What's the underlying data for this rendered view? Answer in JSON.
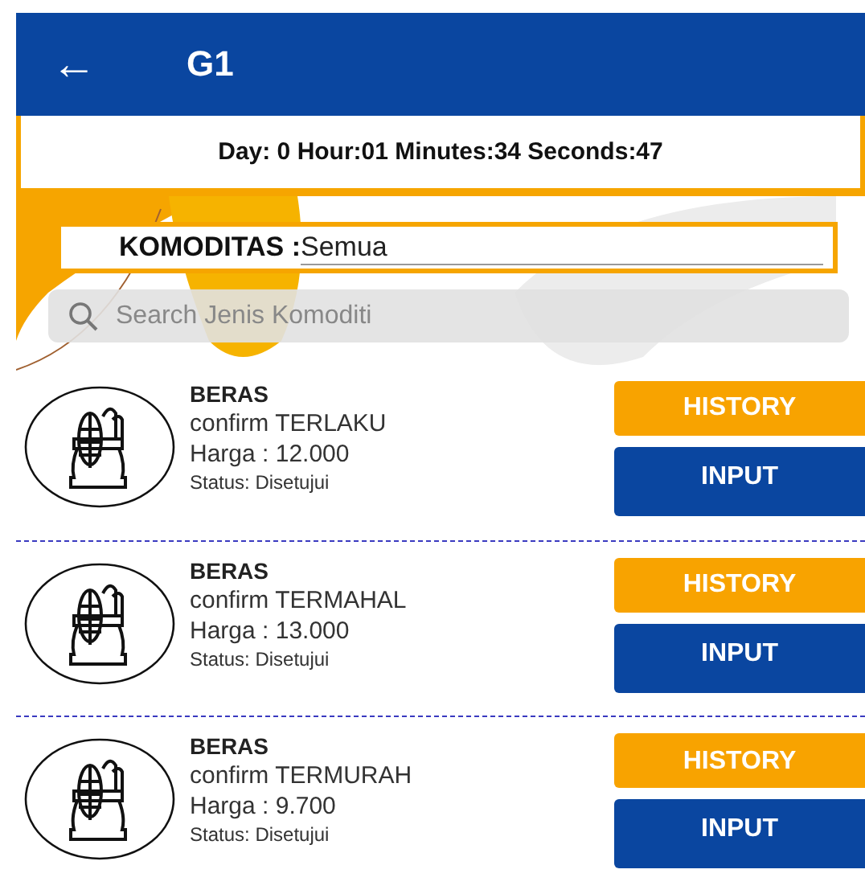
{
  "app_bar": {
    "back": "←",
    "title": "G1"
  },
  "timer": "Day: 0 Hour:01 Minutes:34 Seconds:47",
  "filter": {
    "label": "KOMODITAS :",
    "value": "Semua"
  },
  "search": {
    "placeholder": "Search Jenis Komoditi"
  },
  "items": [
    {
      "name": "BERAS",
      "confirm": "confirm TERLAKU",
      "price": "Harga : 12.000",
      "status": "Status: Disetujui",
      "history": "HISTORY",
      "input": "INPUT"
    },
    {
      "name": "BERAS",
      "confirm": "confirm TERMAHAL",
      "price": "Harga : 13.000",
      "status": "Status: Disetujui",
      "history": "HISTORY",
      "input": "INPUT"
    },
    {
      "name": "BERAS",
      "confirm": "confirm TERMURAH",
      "price": "Harga : 9.700",
      "status": "Status: Disetujui",
      "history": "HISTORY",
      "input": "INPUT"
    }
  ]
}
